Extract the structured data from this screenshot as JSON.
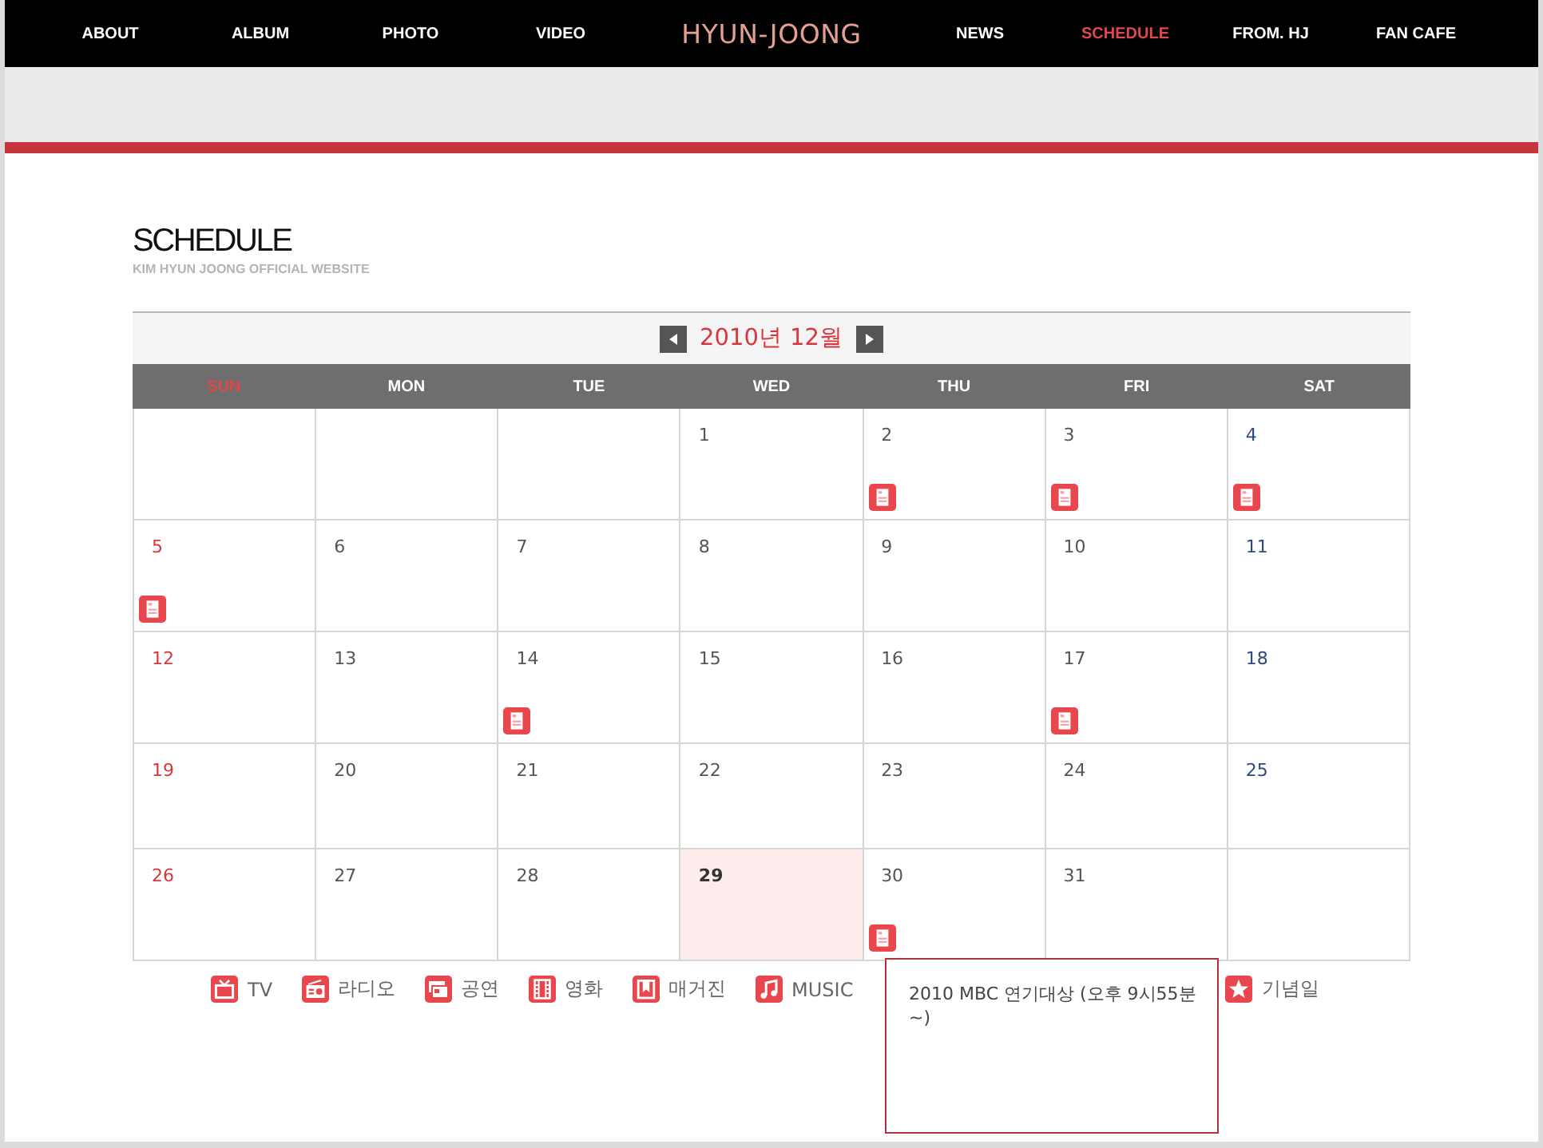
{
  "nav": {
    "left": [
      {
        "label": "ABOUT",
        "selected": false
      },
      {
        "label": "ALBUM",
        "selected": false
      },
      {
        "label": "PHOTO",
        "selected": false
      },
      {
        "label": "VIDEO",
        "selected": false
      }
    ],
    "logo": "HYUN-JOONG",
    "right": [
      {
        "label": "NEWS",
        "selected": false
      },
      {
        "label": "SCHEDULE",
        "selected": true
      },
      {
        "label": "FROM. HJ",
        "selected": false
      },
      {
        "label": "FAN CAFE",
        "selected": false
      }
    ]
  },
  "page": {
    "title": "SCHEDULE",
    "subtitle": "KIM HYUN JOONG OFFICIAL WEBSITE"
  },
  "calendar": {
    "month": "2010년 12월",
    "weekdays": [
      "SUN",
      "MON",
      "TUE",
      "WED",
      "THU",
      "FRI",
      "SAT"
    ],
    "weeks": [
      [
        {
          "kind": "blank"
        },
        {
          "kind": "blank"
        },
        {
          "kind": "blank"
        },
        {
          "kind": "day",
          "day": "1",
          "event": false,
          "today": false
        },
        {
          "kind": "day",
          "day": "2",
          "event": true,
          "today": false
        },
        {
          "kind": "day",
          "day": "3",
          "event": true,
          "today": false
        },
        {
          "kind": "day",
          "day": "4",
          "event": true,
          "today": false
        }
      ],
      [
        {
          "kind": "day",
          "day": "5",
          "event": true,
          "today": false
        },
        {
          "kind": "day",
          "day": "6",
          "event": false,
          "today": false
        },
        {
          "kind": "day",
          "day": "7",
          "event": false,
          "today": false
        },
        {
          "kind": "day",
          "day": "8",
          "event": false,
          "today": false
        },
        {
          "kind": "day",
          "day": "9",
          "event": false,
          "today": false
        },
        {
          "kind": "day",
          "day": "10",
          "event": false,
          "today": false
        },
        {
          "kind": "day",
          "day": "11",
          "event": false,
          "today": false
        }
      ],
      [
        {
          "kind": "day",
          "day": "12",
          "event": false,
          "today": false
        },
        {
          "kind": "day",
          "day": "13",
          "event": false,
          "today": false
        },
        {
          "kind": "day",
          "day": "14",
          "event": true,
          "today": false
        },
        {
          "kind": "day",
          "day": "15",
          "event": false,
          "today": false
        },
        {
          "kind": "day",
          "day": "16",
          "event": false,
          "today": false
        },
        {
          "kind": "day",
          "day": "17",
          "event": true,
          "today": false
        },
        {
          "kind": "day",
          "day": "18",
          "event": false,
          "today": false
        }
      ],
      [
        {
          "kind": "day",
          "day": "19",
          "event": false,
          "today": false
        },
        {
          "kind": "day",
          "day": "20",
          "event": false,
          "today": false
        },
        {
          "kind": "day",
          "day": "21",
          "event": false,
          "today": false
        },
        {
          "kind": "day",
          "day": "22",
          "event": false,
          "today": false
        },
        {
          "kind": "day",
          "day": "23",
          "event": false,
          "today": false
        },
        {
          "kind": "day",
          "day": "24",
          "event": false,
          "today": false
        },
        {
          "kind": "day",
          "day": "25",
          "event": false,
          "today": false
        }
      ],
      [
        {
          "kind": "day",
          "day": "26",
          "event": false,
          "today": false
        },
        {
          "kind": "day",
          "day": "27",
          "event": false,
          "today": false
        },
        {
          "kind": "day",
          "day": "28",
          "event": false,
          "today": false
        },
        {
          "kind": "day",
          "day": "29",
          "event": false,
          "today": true
        },
        {
          "kind": "day",
          "day": "30",
          "event": true,
          "today": false
        },
        {
          "kind": "day",
          "day": "31",
          "event": false,
          "today": false
        },
        {
          "kind": "blank"
        }
      ]
    ]
  },
  "legend": [
    {
      "kind": "tv",
      "label": "TV"
    },
    {
      "kind": "radio",
      "label": "라디오"
    },
    {
      "kind": "concert",
      "label": "공연"
    },
    {
      "kind": "movie",
      "label": "영화"
    },
    {
      "kind": "magazine",
      "label": "매거진"
    },
    {
      "kind": "music",
      "label": "MUSIC"
    },
    {
      "kind": "anniversary",
      "label": "기념일"
    }
  ],
  "tooltip": {
    "text": "2010 MBC 연기대상 (오후 9시55분 ~)"
  }
}
